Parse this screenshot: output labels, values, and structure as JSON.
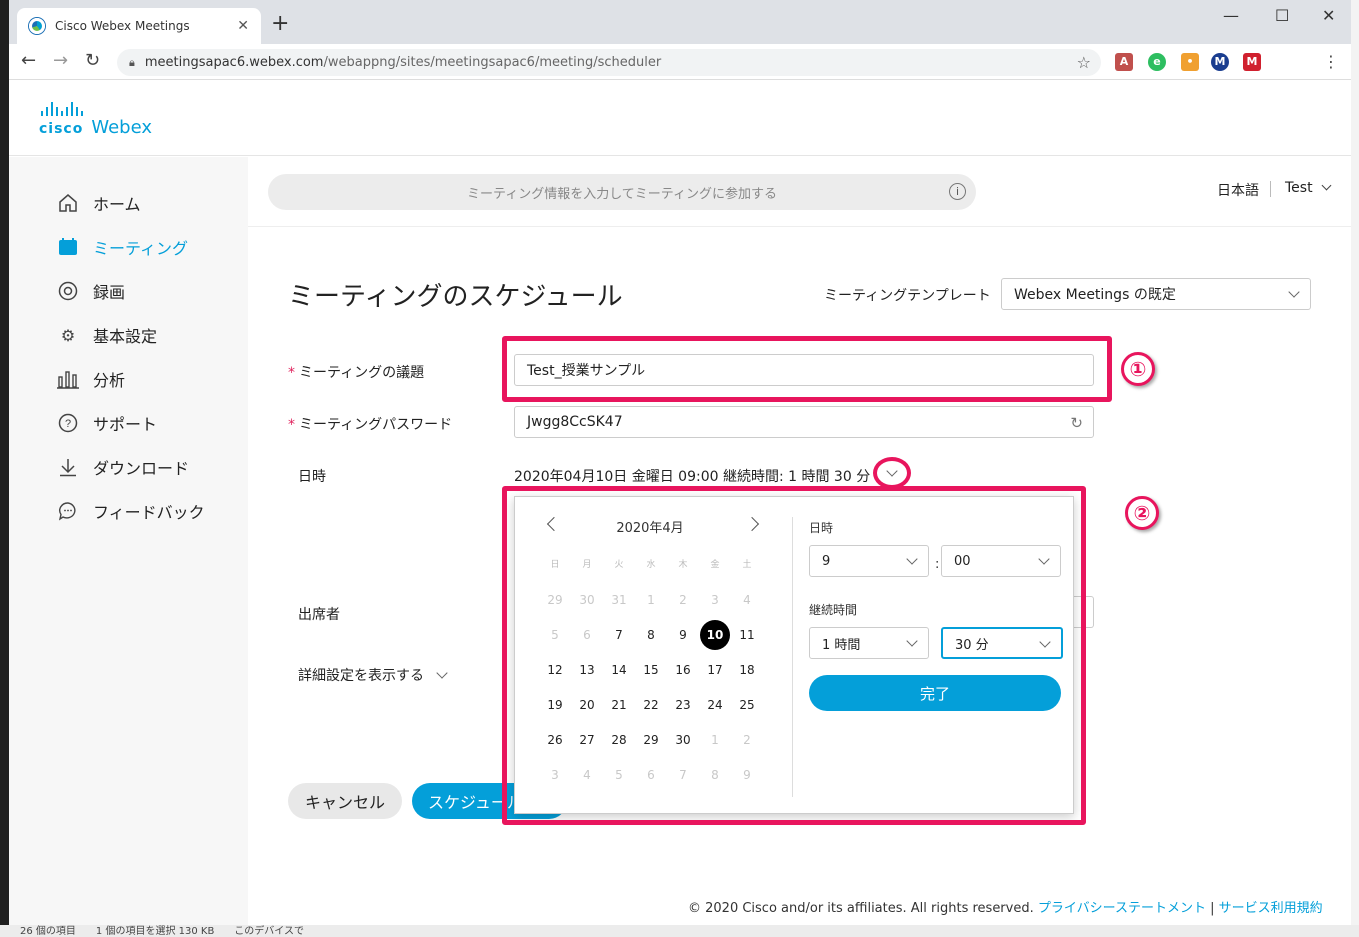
{
  "browser": {
    "tab_title": "Cisco Webex Meetings",
    "url_host": "meetingsapac6.webex.com",
    "url_path": "/webappng/sites/meetingsapac6/meeting/scheduler"
  },
  "brand": {
    "cisco": "cisco",
    "webex": "Webex"
  },
  "sidebar": {
    "items": [
      {
        "label": "ホーム",
        "icon": "home-icon"
      },
      {
        "label": "ミーティング",
        "icon": "calendar-icon",
        "active": true
      },
      {
        "label": "録画",
        "icon": "record-icon"
      },
      {
        "label": "基本設定",
        "icon": "gear-icon"
      },
      {
        "label": "分析",
        "icon": "bar-chart-icon"
      },
      {
        "label": "サポート",
        "icon": "help-icon"
      },
      {
        "label": "ダウンロード",
        "icon": "download-icon"
      },
      {
        "label": "フィードバック",
        "icon": "chat-bubble-icon"
      }
    ]
  },
  "header": {
    "search_placeholder": "ミーティング情報を入力してミーティングに参加する",
    "language": "日本語",
    "user": "Test"
  },
  "page": {
    "title": "ミーティングのスケジュール",
    "template_label": "ミーティングテンプレート",
    "template_value": "Webex Meetings の既定"
  },
  "form": {
    "topic_label": "ミーティングの議題",
    "topic_value": "Test_授業サンプル",
    "password_label": "ミーティングパスワード",
    "password_value": "Jwgg8CcSK47",
    "datetime_label": "日時",
    "datetime_value": "2020年04月10日 金曜日 09:00  継続時間:  1 時間 30 分",
    "attendees_label": "出席者",
    "advanced_label": "詳細設定を表示する"
  },
  "picker": {
    "month_label": "2020年4月",
    "weekdays": [
      "日",
      "月",
      "火",
      "水",
      "木",
      "金",
      "土"
    ],
    "days": [
      [
        "29",
        "m"
      ],
      [
        "30",
        "m"
      ],
      [
        "31",
        "m"
      ],
      [
        "1",
        "m"
      ],
      [
        "2",
        "m"
      ],
      [
        "3",
        "m"
      ],
      [
        "4",
        "m"
      ],
      [
        "5",
        "m"
      ],
      [
        "6",
        "m"
      ],
      [
        "7",
        ""
      ],
      [
        "8",
        ""
      ],
      [
        "9",
        ""
      ],
      [
        "10",
        "sel"
      ],
      [
        "11",
        ""
      ],
      [
        "12",
        ""
      ],
      [
        "13",
        ""
      ],
      [
        "14",
        ""
      ],
      [
        "15",
        ""
      ],
      [
        "16",
        ""
      ],
      [
        "17",
        ""
      ],
      [
        "18",
        ""
      ],
      [
        "19",
        ""
      ],
      [
        "20",
        ""
      ],
      [
        "21",
        ""
      ],
      [
        "22",
        ""
      ],
      [
        "23",
        ""
      ],
      [
        "24",
        ""
      ],
      [
        "25",
        ""
      ],
      [
        "26",
        ""
      ],
      [
        "27",
        ""
      ],
      [
        "28",
        ""
      ],
      [
        "29",
        ""
      ],
      [
        "30",
        ""
      ],
      [
        "1",
        "m"
      ],
      [
        "2",
        "m"
      ],
      [
        "3",
        "m"
      ],
      [
        "4",
        "m"
      ],
      [
        "5",
        "m"
      ],
      [
        "6",
        "m"
      ],
      [
        "7",
        "m"
      ],
      [
        "8",
        "m"
      ],
      [
        "9",
        "m"
      ]
    ],
    "time_label": "日時",
    "hour_value": "9",
    "minute_value": "00",
    "duration_label": "継続時間",
    "duration_hours": "1 時間",
    "duration_minutes": "30 分",
    "done_label": "完了"
  },
  "annotations": {
    "one": "①",
    "two": "②"
  },
  "actions": {
    "cancel_label": "キャンセル",
    "schedule_label": "スケジュール"
  },
  "footer": {
    "copyright": "© 2020 Cisco and/or its affiliates. All rights reserved.",
    "privacy": "プライバシーステートメント",
    "terms": "サービス利用規約"
  },
  "taskbar": {
    "status": "26 個の項目　　1 個の項目を選択 130 KB　　このデバイスで"
  },
  "colors": {
    "accent": "#049fd9",
    "annotation": "#e8155d"
  }
}
